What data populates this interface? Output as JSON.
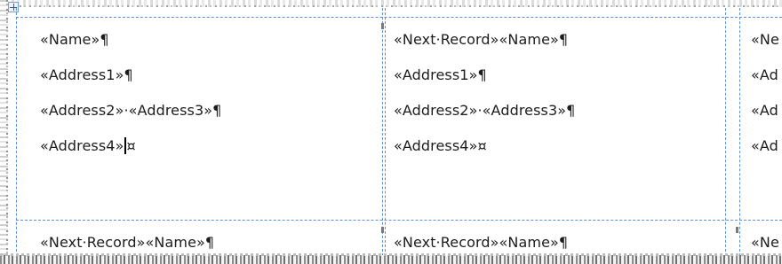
{
  "labels": {
    "r1c1": {
      "line1": "«Name»¶",
      "line2": "«Address1»¶",
      "line3": "«Address2»·«Address3»¶",
      "line4": "«Address4»",
      "line4_end": "¤"
    },
    "r1c2": {
      "line1": "«Next·Record»«Name»¶",
      "line2": "«Address1»¶",
      "line3": "«Address2»·«Address3»¶",
      "line4": "«Address4»¤"
    },
    "r1c3": {
      "line1": "«Ne",
      "line2": "«Ad",
      "line3": "«Ad",
      "line4": "«Ad"
    },
    "r2c1": {
      "line1": "«Next·Record»«Name»¶"
    },
    "r2c2": {
      "line1": "«Next·Record»«Name»¶"
    },
    "r2c3": {
      "line1": "«Ne"
    }
  },
  "colors": {
    "gridline": "#5b8fd6",
    "text": "#1c1c1c"
  }
}
